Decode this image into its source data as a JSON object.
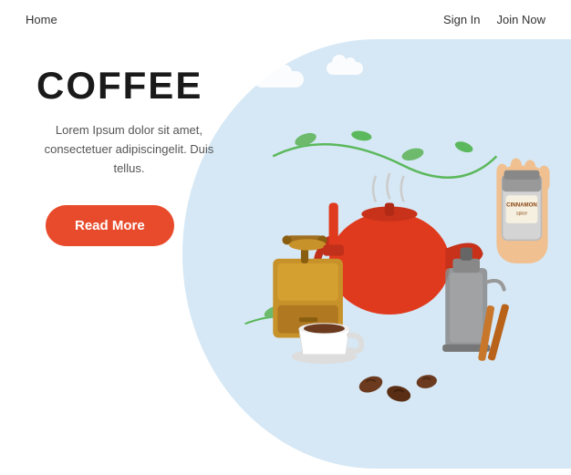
{
  "nav": {
    "home_label": "Home",
    "signin_label": "Sign In",
    "joinnow_label": "Join Now"
  },
  "hero": {
    "title": "COFFEE",
    "description": "Lorem Ipsum dolor sit amet, consectetuer adipiscingelit. Duis tellus.",
    "cta_label": "Read More"
  },
  "colors": {
    "accent": "#e84b2b",
    "bg_blue": "#d6e8f5",
    "text_dark": "#1a1a1a",
    "text_body": "#555555"
  }
}
